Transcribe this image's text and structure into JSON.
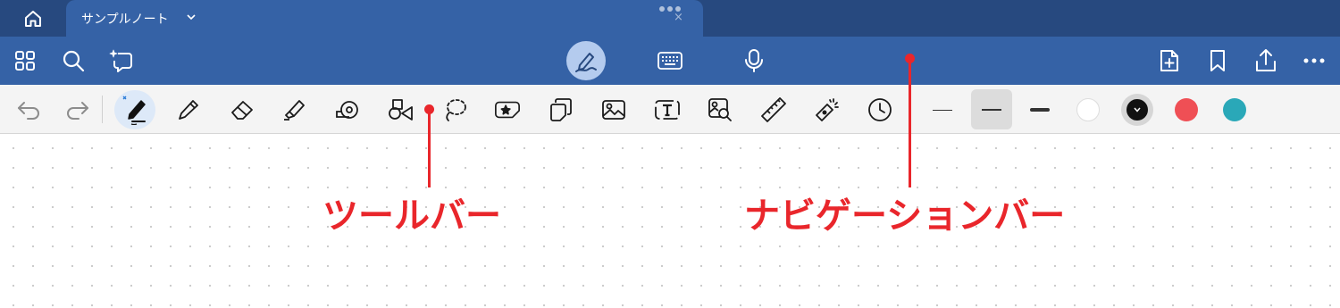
{
  "tabbar": {
    "home_icon": "home-icon",
    "tab_title": "サンプルノート",
    "tab_more": "•••",
    "tab_close": "×"
  },
  "navbar": {
    "left_icons": [
      "grid-icon",
      "search-icon",
      "ai-assist-icon"
    ],
    "center_icons": [
      "pen-mode-icon",
      "keyboard-icon",
      "microphone-icon"
    ],
    "right_icons": [
      "add-page-icon",
      "bookmark-icon",
      "share-icon",
      "more-icon"
    ]
  },
  "toolbar": {
    "tools": [
      "undo-icon",
      "redo-icon",
      "pen-icon",
      "pencil-icon",
      "eraser-icon",
      "highlighter-icon",
      "tape-icon",
      "shapes-icon",
      "lasso-icon",
      "sticker-icon",
      "copy-paste-icon",
      "image-icon",
      "textbox-icon",
      "image-search-icon",
      "ruler-icon",
      "laser-pointer-icon",
      "history-icon"
    ],
    "thickness": [
      "thin",
      "medium",
      "thick"
    ],
    "colors": [
      "#ffffff",
      "#111111",
      "#ef4f55",
      "#2aa8b8"
    ],
    "selected_color": "#111111",
    "accent": "#3562a6"
  },
  "annotations": {
    "toolbar_label": "ツールバー",
    "navbar_label": "ナビゲーションバー",
    "color": "#e9262b"
  }
}
